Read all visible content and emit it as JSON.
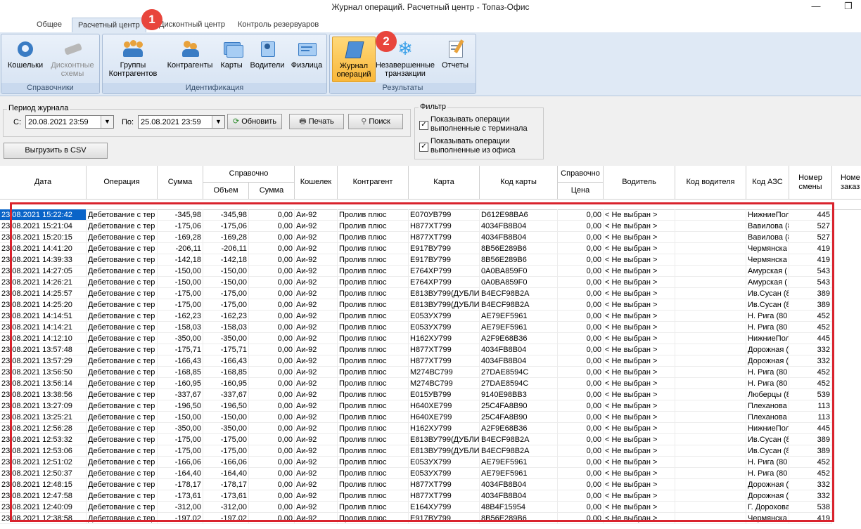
{
  "window": {
    "title": "Журнал операций. Расчетный центр - Топаз-Офис",
    "minimize_icon": "—",
    "restore_icon": "❐"
  },
  "tabs": [
    "Общее",
    "Расчетный центр",
    "Дисконтный центр",
    "Контроль резервуаров"
  ],
  "markers": [
    "1",
    "2"
  ],
  "ribbon": {
    "groups": [
      {
        "caption": "Справочники"
      },
      {
        "caption": "Идентификация"
      },
      {
        "caption": "Результаты"
      }
    ],
    "buttons": [
      {
        "label1": "Кошельки",
        "label2": ""
      },
      {
        "label1": "Дисконтные",
        "label2": "схемы"
      },
      {
        "label1": "Группы",
        "label2": "Контрагентов"
      },
      {
        "label1": "Контрагенты",
        "label2": ""
      },
      {
        "label1": "Карты",
        "label2": ""
      },
      {
        "label1": "Водители",
        "label2": ""
      },
      {
        "label1": "Физлица",
        "label2": ""
      },
      {
        "label1": "Журнал",
        "label2": "операций"
      },
      {
        "label1": "Незавершенные",
        "label2": "транзакции"
      },
      {
        "label1": "Отчеты",
        "label2": ""
      }
    ]
  },
  "period": {
    "title": "Период журнала",
    "from_label": "С:",
    "from_value": "20.08.2021 23:59",
    "to_label": "По:",
    "to_value": "25.08.2021 23:59",
    "refresh": "Обновить",
    "print": "Печать",
    "search": "Поиск",
    "export": "Выгрузить в CSV"
  },
  "filter": {
    "title": "Фильтр",
    "opt1_line1": "Показывать операции",
    "opt1_line2": "выполненные с терминала",
    "opt2_line1": "Показывать операции",
    "opt2_line2": "выполненные из офиса",
    "check": "✓"
  },
  "grid": {
    "headers": {
      "date": "Дата",
      "operation": "Операция",
      "sum": "Сумма",
      "ref_group": "Справочно",
      "volume": "Объем",
      "ref_sum": "Сумма",
      "wallet": "Кошелек",
      "contractor": "Контрагент",
      "card": "Карта",
      "card_code": "Код карты",
      "price_group": "Справочно",
      "price": "Цена",
      "driver": "Водитель",
      "driver_code": "Код водителя",
      "azs_code": "Код АЗС",
      "shift_l1": "Номер",
      "shift_l2": "смены",
      "order_l1": "Номе",
      "order_l2": "заказ"
    },
    "rows": [
      [
        "23.08.2021 15:22:42",
        "Дебетование с тер",
        "-345,98",
        "-345,98",
        "0,00",
        "Аи-92",
        "Пролив плюс",
        "Е070УВ799",
        "D612E98BA6",
        "0,00",
        "< Не выбран >",
        "",
        "НижниеПол",
        "445"
      ],
      [
        "23.08.2021 15:21:04",
        "Дебетование с тер",
        "-175,06",
        "-175,06",
        "0,00",
        "Аи-92",
        "Пролив плюс",
        "Н877ХТ799",
        "4034FB8B04",
        "0,00",
        "< Не выбран >",
        "",
        "Вавилова (8",
        "527"
      ],
      [
        "23.08.2021 15:20:15",
        "Дебетование с тер",
        "-169,28",
        "-169,28",
        "0,00",
        "Аи-92",
        "Пролив плюс",
        "Н877ХТ799",
        "4034FB8B04",
        "0,00",
        "< Не выбран >",
        "",
        "Вавилова (8",
        "527"
      ],
      [
        "23.08.2021 14:41:20",
        "Дебетование с тер",
        "-206,11",
        "-206,11",
        "0,00",
        "Аи-92",
        "Пролив плюс",
        "Е917ВУ799",
        "8B56E289B6",
        "0,00",
        "< Не выбран >",
        "",
        "Чермянска",
        "419"
      ],
      [
        "23.08.2021 14:39:33",
        "Дебетование с тер",
        "-142,18",
        "-142,18",
        "0,00",
        "Аи-92",
        "Пролив плюс",
        "Е917ВУ799",
        "8B56E289B6",
        "0,00",
        "< Не выбран >",
        "",
        "Чермянска",
        "419"
      ],
      [
        "23.08.2021 14:27:05",
        "Дебетование с тер",
        "-150,00",
        "-150,00",
        "0,00",
        "Аи-92",
        "Пролив плюс",
        "Е764ХР799",
        "0A0BA859F0",
        "0,00",
        "< Не выбран >",
        "",
        "Амурская (",
        "543"
      ],
      [
        "23.08.2021 14:26:21",
        "Дебетование с тер",
        "-150,00",
        "-150,00",
        "0,00",
        "Аи-92",
        "Пролив плюс",
        "Е764ХР799",
        "0A0BA859F0",
        "0,00",
        "< Не выбран >",
        "",
        "Амурская (",
        "543"
      ],
      [
        "23.08.2021 14:25:57",
        "Дебетование с тер",
        "-175,00",
        "-175,00",
        "0,00",
        "Аи-92",
        "Пролив плюс",
        "Е813ВУ799(ДУБЛИ",
        "B4ECF98B2A",
        "0,00",
        "< Не выбран >",
        "",
        "Ив.Сусан (8",
        "389"
      ],
      [
        "23.08.2021 14:25:20",
        "Дебетование с тер",
        "-175,00",
        "-175,00",
        "0,00",
        "Аи-92",
        "Пролив плюс",
        "Е813ВУ799(ДУБЛИ",
        "B4ECF98B2A",
        "0,00",
        "< Не выбран >",
        "",
        "Ив.Сусан (8",
        "389"
      ],
      [
        "23.08.2021 14:14:51",
        "Дебетование с тер",
        "-162,23",
        "-162,23",
        "0,00",
        "Аи-92",
        "Пролив плюс",
        "Е053УХ799",
        "AE79EF5961",
        "0,00",
        "< Не выбран >",
        "",
        "Н. Рига (80",
        "452"
      ],
      [
        "23.08.2021 14:14:21",
        "Дебетование с тер",
        "-158,03",
        "-158,03",
        "0,00",
        "Аи-92",
        "Пролив плюс",
        "Е053УХ799",
        "AE79EF5961",
        "0,00",
        "< Не выбран >",
        "",
        "Н. Рига (80",
        "452"
      ],
      [
        "23.08.2021 14:12:10",
        "Дебетование с тер",
        "-350,00",
        "-350,00",
        "0,00",
        "Аи-92",
        "Пролив плюс",
        "Н162ХУ799",
        "A2F9E68B36",
        "0,00",
        "< Не выбран >",
        "",
        "НижниеПол",
        "445"
      ],
      [
        "23.08.2021 13:57:48",
        "Дебетование с тер",
        "-175,71",
        "-175,71",
        "0,00",
        "Аи-92",
        "Пролив плюс",
        "Н877ХТ799",
        "4034FB8B04",
        "0,00",
        "< Не выбран >",
        "",
        "Дорожная (",
        "332"
      ],
      [
        "23.08.2021 13:57:29",
        "Дебетование с тер",
        "-166,43",
        "-166,43",
        "0,00",
        "Аи-92",
        "Пролив плюс",
        "Н877ХТ799",
        "4034FB8B04",
        "0,00",
        "< Не выбран >",
        "",
        "Дорожная (",
        "332"
      ],
      [
        "23.08.2021 13:56:50",
        "Дебетование с тер",
        "-168,85",
        "-168,85",
        "0,00",
        "Аи-92",
        "Пролив плюс",
        "М274ВС799",
        "27DAE8594C",
        "0,00",
        "< Не выбран >",
        "",
        "Н. Рига (80",
        "452"
      ],
      [
        "23.08.2021 13:56:14",
        "Дебетование с тер",
        "-160,95",
        "-160,95",
        "0,00",
        "Аи-92",
        "Пролив плюс",
        "М274ВС799",
        "27DAE8594C",
        "0,00",
        "< Не выбран >",
        "",
        "Н. Рига (80",
        "452"
      ],
      [
        "23.08.2021 13:38:56",
        "Дебетование с тер",
        "-337,67",
        "-337,67",
        "0,00",
        "Аи-92",
        "Пролив плюс",
        "Е015УВ799",
        "9140E98BB3",
        "0,00",
        "< Не выбран >",
        "",
        "Люберцы (8",
        "539"
      ],
      [
        "23.08.2021 13:27:09",
        "Дебетование с тер",
        "-196,50",
        "-196,50",
        "0,00",
        "Аи-92",
        "Пролив плюс",
        "Н640ХЕ799",
        "25C4FA8B90",
        "0,00",
        "< Не выбран >",
        "",
        "Плеханова",
        "113"
      ],
      [
        "23.08.2021 13:25:21",
        "Дебетование с тер",
        "-150,00",
        "-150,00",
        "0,00",
        "Аи-92",
        "Пролив плюс",
        "Н640ХЕ799",
        "25C4FA8B90",
        "0,00",
        "< Не выбран >",
        "",
        "Плеханова",
        "113"
      ],
      [
        "23.08.2021 12:56:28",
        "Дебетование с тер",
        "-350,00",
        "-350,00",
        "0,00",
        "Аи-92",
        "Пролив плюс",
        "Н162ХУ799",
        "A2F9E68B36",
        "0,00",
        "< Не выбран >",
        "",
        "НижниеПол",
        "445"
      ],
      [
        "23.08.2021 12:53:32",
        "Дебетование с тер",
        "-175,00",
        "-175,00",
        "0,00",
        "Аи-92",
        "Пролив плюс",
        "Е813ВУ799(ДУБЛИ",
        "B4ECF98B2A",
        "0,00",
        "< Не выбран >",
        "",
        "Ив.Сусан (8",
        "389"
      ],
      [
        "23.08.2021 12:53:06",
        "Дебетование с тер",
        "-175,00",
        "-175,00",
        "0,00",
        "Аи-92",
        "Пролив плюс",
        "Е813ВУ799(ДУБЛИ",
        "B4ECF98B2A",
        "0,00",
        "< Не выбран >",
        "",
        "Ив.Сусан (8",
        "389"
      ],
      [
        "23.08.2021 12:51:02",
        "Дебетование с тер",
        "-166,06",
        "-166,06",
        "0,00",
        "Аи-92",
        "Пролив плюс",
        "Е053УХ799",
        "AE79EF5961",
        "0,00",
        "< Не выбран >",
        "",
        "Н. Рига (80",
        "452"
      ],
      [
        "23.08.2021 12:50:37",
        "Дебетование с тер",
        "-164,40",
        "-164,40",
        "0,00",
        "Аи-92",
        "Пролив плюс",
        "Е053УХ799",
        "AE79EF5961",
        "0,00",
        "< Не выбран >",
        "",
        "Н. Рига (80",
        "452"
      ],
      [
        "23.08.2021 12:48:15",
        "Дебетование с тер",
        "-178,17",
        "-178,17",
        "0,00",
        "Аи-92",
        "Пролив плюс",
        "Н877ХТ799",
        "4034FB8B04",
        "0,00",
        "< Не выбран >",
        "",
        "Дорожная (",
        "332"
      ],
      [
        "23.08.2021 12:47:58",
        "Дебетование с тер",
        "-173,61",
        "-173,61",
        "0,00",
        "Аи-92",
        "Пролив плюс",
        "Н877ХТ799",
        "4034FB8B04",
        "0,00",
        "< Не выбран >",
        "",
        "Дорожная (",
        "332"
      ],
      [
        "23.08.2021 12:40:09",
        "Дебетование с тер",
        "-312,00",
        "-312,00",
        "0,00",
        "Аи-92",
        "Пролив плюс",
        "Е164ХУ799",
        "48B4F15954",
        "0,00",
        "< Не выбран >",
        "",
        "Г. Дорохова",
        "538"
      ],
      [
        "23.08.2021 12:38:58",
        "Дебетование с тер",
        "-197,02",
        "-197,02",
        "0,00",
        "Аи-92",
        "Пролив плюс",
        "Е917ВУ799",
        "8B56E289B6",
        "0,00",
        "< Не выбран >",
        "",
        "Чермянска",
        "419"
      ]
    ]
  }
}
